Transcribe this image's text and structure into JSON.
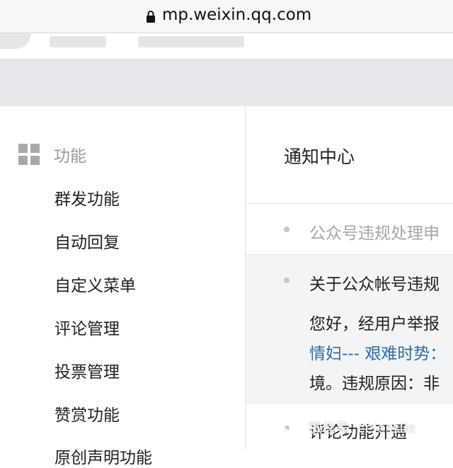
{
  "browser": {
    "url": "mp.weixin.qq.com",
    "lock_icon": "lock-icon"
  },
  "sidebar": {
    "section_icon": "grid-icon",
    "section_label": "功能",
    "items": [
      {
        "label": "群发功能"
      },
      {
        "label": "自动回复"
      },
      {
        "label": "自定义菜单"
      },
      {
        "label": "评论管理"
      },
      {
        "label": "投票管理"
      },
      {
        "label": "赞赏功能"
      },
      {
        "label": "原创声明功能"
      }
    ]
  },
  "main": {
    "title": "通知中心",
    "notices": [
      {
        "title": "公众号违规处理申"
      },
      {
        "title": "关于公众帐号违规",
        "body_line1": "您好，经用户举报",
        "body_link": "情妇--- 艰难时势：",
        "body_line3": "境。违规原因：非"
      },
      {
        "title": "评论功能开通"
      }
    ]
  },
  "watermark": {
    "text": "微信号: celesslie",
    "icon": "wechat-logo-icon"
  },
  "colors": {
    "link": "#2b6ea8",
    "sidebar_border": "#e4e4e4",
    "banner": "#e7e8ec"
  }
}
